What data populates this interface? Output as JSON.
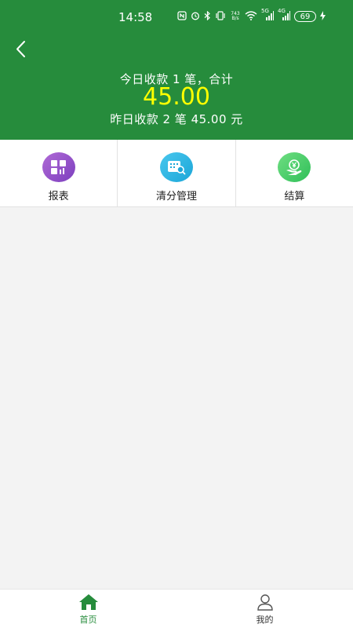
{
  "status_bar": {
    "time": "14:58",
    "net_speed_top": "743",
    "net_speed_bottom": "B/s",
    "signal1": "5G",
    "signal2": "4G",
    "battery": "69",
    "icons": [
      "nfc-icon",
      "alarm-icon",
      "bluetooth-icon",
      "vibrate-icon",
      "wifi-icon",
      "signal-icon",
      "charging-icon"
    ]
  },
  "header": {
    "today_text": "今日收款 1 笔，合计",
    "amount": "45.00",
    "yesterday_text": "昨日收款 2 笔 45.00 元",
    "color": "#268c3c",
    "amount_color": "#ffff00"
  },
  "menu": {
    "items": [
      {
        "label": "报表",
        "icon": "report-icon"
      },
      {
        "label": "清分管理",
        "icon": "settlement-icon"
      },
      {
        "label": "结算",
        "icon": "checkout-icon"
      }
    ]
  },
  "tabbar": {
    "tabs": [
      {
        "label": "首页",
        "icon": "home-icon",
        "active": true
      },
      {
        "label": "我的",
        "icon": "user-icon",
        "active": false
      }
    ],
    "active_color": "#268c3c"
  }
}
